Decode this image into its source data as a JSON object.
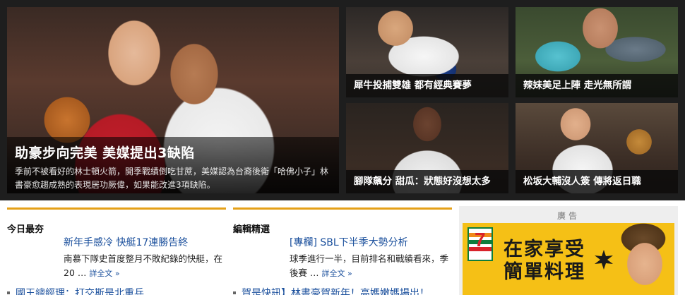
{
  "hero": {
    "title": "助豪步向完美 美媒提出3缺陷",
    "description": "季前不被看好的林士頓火箭，開季戰績倒吃甘蔗，美媒認為台裔後衛「哈佛小子」林書豪愈趨成熟的表現居功厥偉，如果能改進3項缺陷。"
  },
  "tiles": [
    {
      "caption": "犀牛投捕雙雄 都有經典賽夢"
    },
    {
      "caption": "辣妹美足上陣 走光無所謂"
    },
    {
      "caption": "腳隊飆分 甜瓜：狀態好沒想太多"
    },
    {
      "caption": "松坂大輔沒人簽 傳將返日職"
    }
  ],
  "today": {
    "heading": "今日最夯",
    "item_title": "新年手感冷 快艇17連勝告終",
    "item_desc": "南慕下隊史首度整月不敗紀錄的快艇，在20 …",
    "more": "詳全文 »",
    "next_title": "國王總經理：打交斯是北重兵"
  },
  "editor": {
    "heading": "編輯精選",
    "item_title": "[專欄] SBL下半季大勢分析",
    "item_desc": "球季進行一半，目前排名和戰績看來，季後賽 …",
    "more": "詳全文 »",
    "next_title": "賀是快訊】林書豪賀新年！高媽嫩媽場出！"
  },
  "ad": {
    "label": "廣告",
    "headline_line1": "在家享受",
    "headline_line2": "簡單料理",
    "logo_text": "7",
    "colors": {
      "background": "#f5c016",
      "logo_green": "#0f7d3c",
      "logo_orange": "#f08a1c",
      "logo_red": "#d8232a"
    }
  },
  "colors": {
    "accent": "#e5a118",
    "link": "#1a4f9c",
    "band": "#1e1e1e"
  }
}
